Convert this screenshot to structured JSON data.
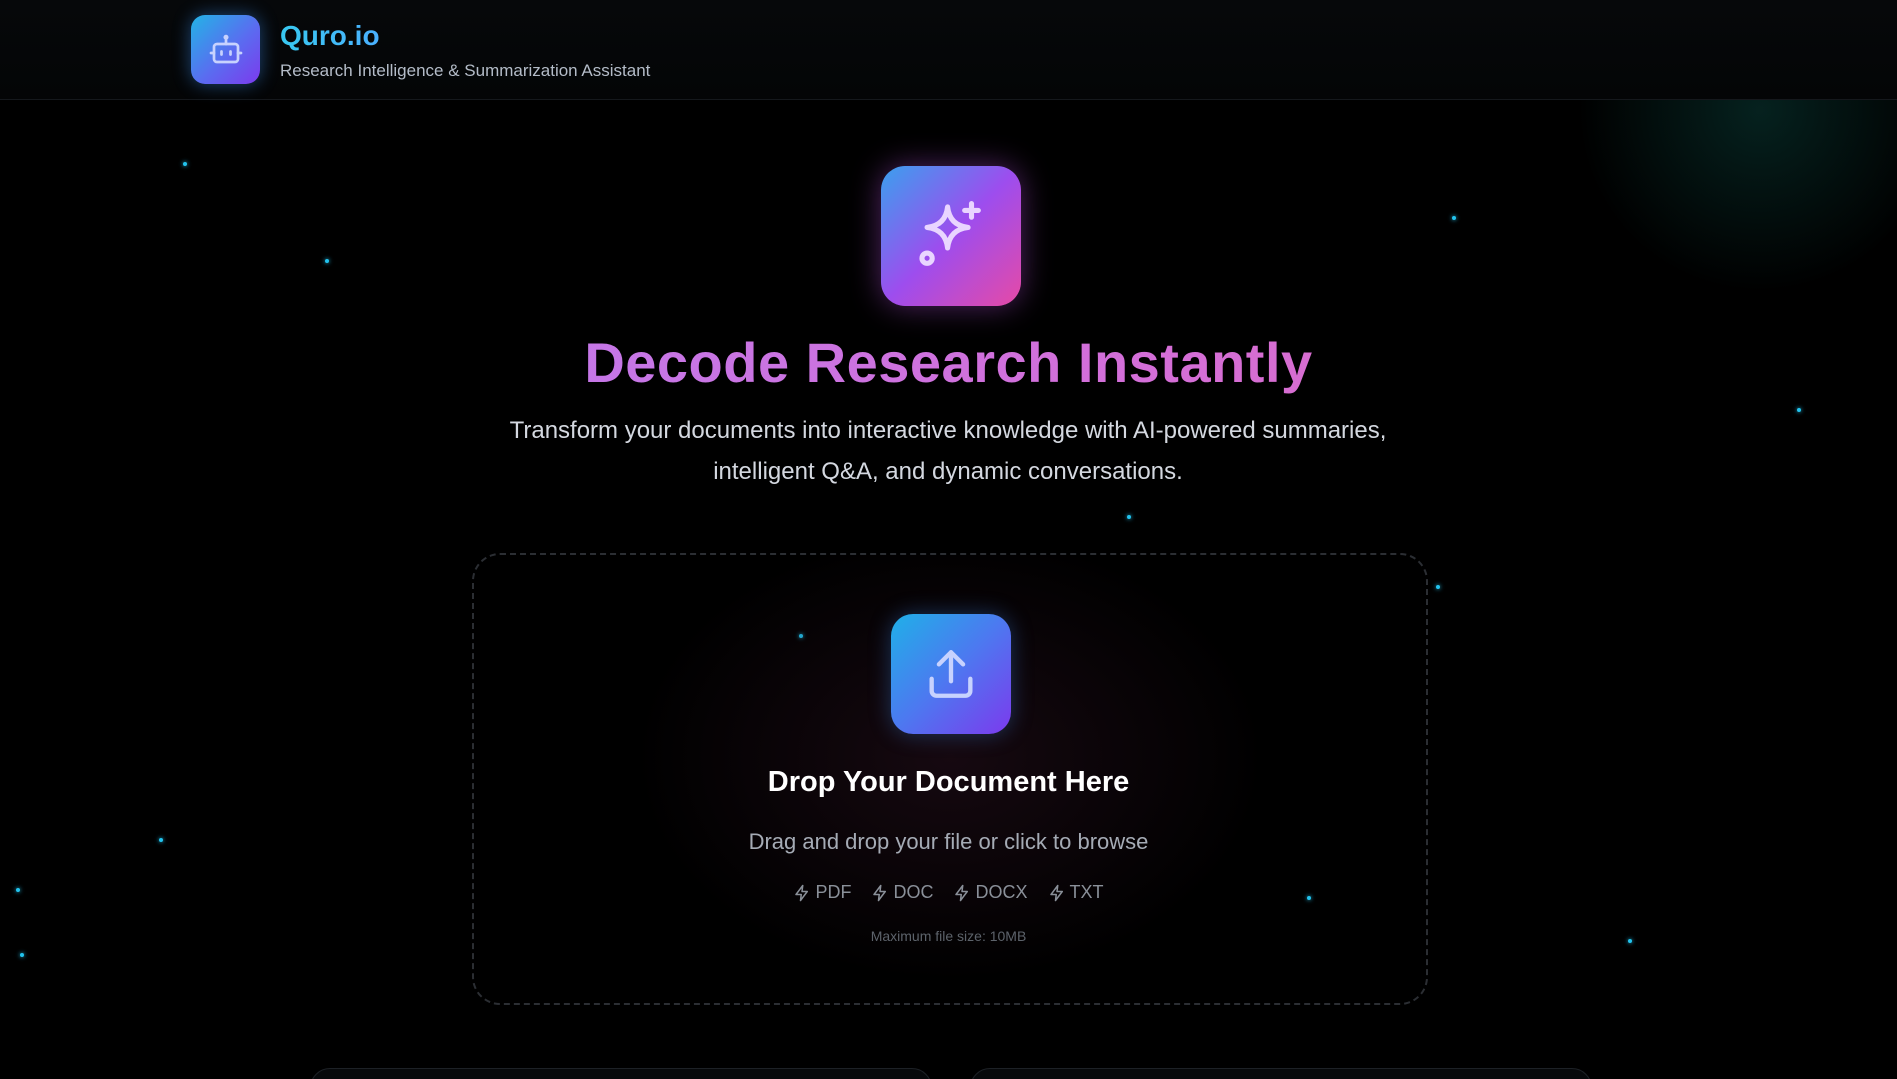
{
  "header": {
    "brand_name": "Quro.io",
    "tagline": "Research Intelligence & Summarization Assistant",
    "logo_icon": "robot-icon"
  },
  "hero": {
    "icon": "sparkles-icon",
    "title": "Decode Research Instantly",
    "subtitle_line1": "Transform your documents into interactive knowledge with AI-powered summaries,",
    "subtitle_line2": "intelligent Q&A, and dynamic conversations."
  },
  "dropzone": {
    "icon": "upload-icon",
    "title": "Drop Your Document Here",
    "subtitle": "Drag and drop your file or click to browse",
    "formats": [
      {
        "label": "PDF",
        "icon": "zap-icon"
      },
      {
        "label": "DOC",
        "icon": "zap-icon"
      },
      {
        "label": "DOCX",
        "icon": "zap-icon"
      },
      {
        "label": "TXT",
        "icon": "zap-icon"
      }
    ],
    "max_size": "Maximum file size: 10MB"
  },
  "colors": {
    "accent_cyan": "#22c3ee",
    "accent_purple": "#7c3aed",
    "accent_pink": "#e64aa6",
    "background": "#000000"
  }
}
